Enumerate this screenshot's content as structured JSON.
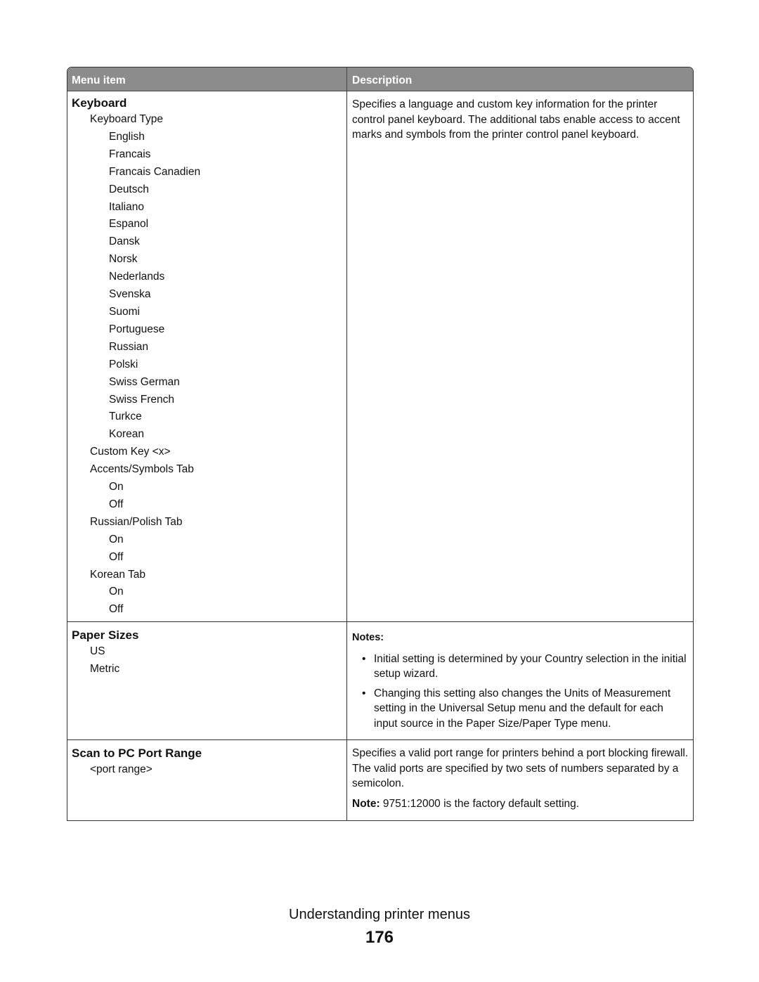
{
  "table": {
    "headers": {
      "menu_item": "Menu item",
      "description": "Description"
    },
    "rows": [
      {
        "title": "Keyboard",
        "items": [
          {
            "level": 1,
            "text": "Keyboard Type"
          },
          {
            "level": 2,
            "text": "English"
          },
          {
            "level": 2,
            "text": "Francais"
          },
          {
            "level": 2,
            "text": "Francais Canadien"
          },
          {
            "level": 2,
            "text": "Deutsch"
          },
          {
            "level": 2,
            "text": "Italiano"
          },
          {
            "level": 2,
            "text": "Espanol"
          },
          {
            "level": 2,
            "text": "Dansk"
          },
          {
            "level": 2,
            "text": "Norsk"
          },
          {
            "level": 2,
            "text": "Nederlands"
          },
          {
            "level": 2,
            "text": "Svenska"
          },
          {
            "level": 2,
            "text": "Suomi"
          },
          {
            "level": 2,
            "text": "Portuguese"
          },
          {
            "level": 2,
            "text": "Russian"
          },
          {
            "level": 2,
            "text": "Polski"
          },
          {
            "level": 2,
            "text": "Swiss German"
          },
          {
            "level": 2,
            "text": "Swiss French"
          },
          {
            "level": 2,
            "text": "Turkce"
          },
          {
            "level": 2,
            "text": "Korean"
          },
          {
            "level": 1,
            "text": "Custom Key <x>"
          },
          {
            "level": 1,
            "text": "Accents/Symbols Tab"
          },
          {
            "level": 2,
            "text": "On"
          },
          {
            "level": 2,
            "text": "Off"
          },
          {
            "level": 1,
            "text": "Russian/Polish Tab"
          },
          {
            "level": 2,
            "text": "On"
          },
          {
            "level": 2,
            "text": "Off"
          },
          {
            "level": 1,
            "text": "Korean Tab"
          },
          {
            "level": 2,
            "text": "On"
          },
          {
            "level": 2,
            "text": "Off"
          }
        ],
        "description": "Specifies a language and custom key information for the printer control panel keyboard. The additional tabs enable access to accent marks and symbols from the printer control panel keyboard."
      },
      {
        "title": "Paper Sizes",
        "items": [
          {
            "level": 1,
            "text": "US"
          },
          {
            "level": 1,
            "text": "Metric"
          }
        ],
        "notes_label": "Notes:",
        "notes": [
          "Initial setting is determined by your Country selection in the initial setup wizard.",
          "Changing this setting also changes the Units of Measurement setting in the Universal Setup menu and the default for each input source in the Paper Size/Paper Type menu."
        ]
      },
      {
        "title": "Scan to PC Port Range",
        "items": [
          {
            "level": 1,
            "text": "<port range>"
          }
        ],
        "description": "Specifies a valid port range for printers behind a port blocking firewall. The valid ports are specified by two sets of numbers separated by a semicolon.",
        "note_label": "Note:",
        "note_text": " 9751:12000 is the factory default setting."
      }
    ]
  },
  "footer": {
    "section_title": "Understanding printer menus",
    "page_number": "176"
  }
}
